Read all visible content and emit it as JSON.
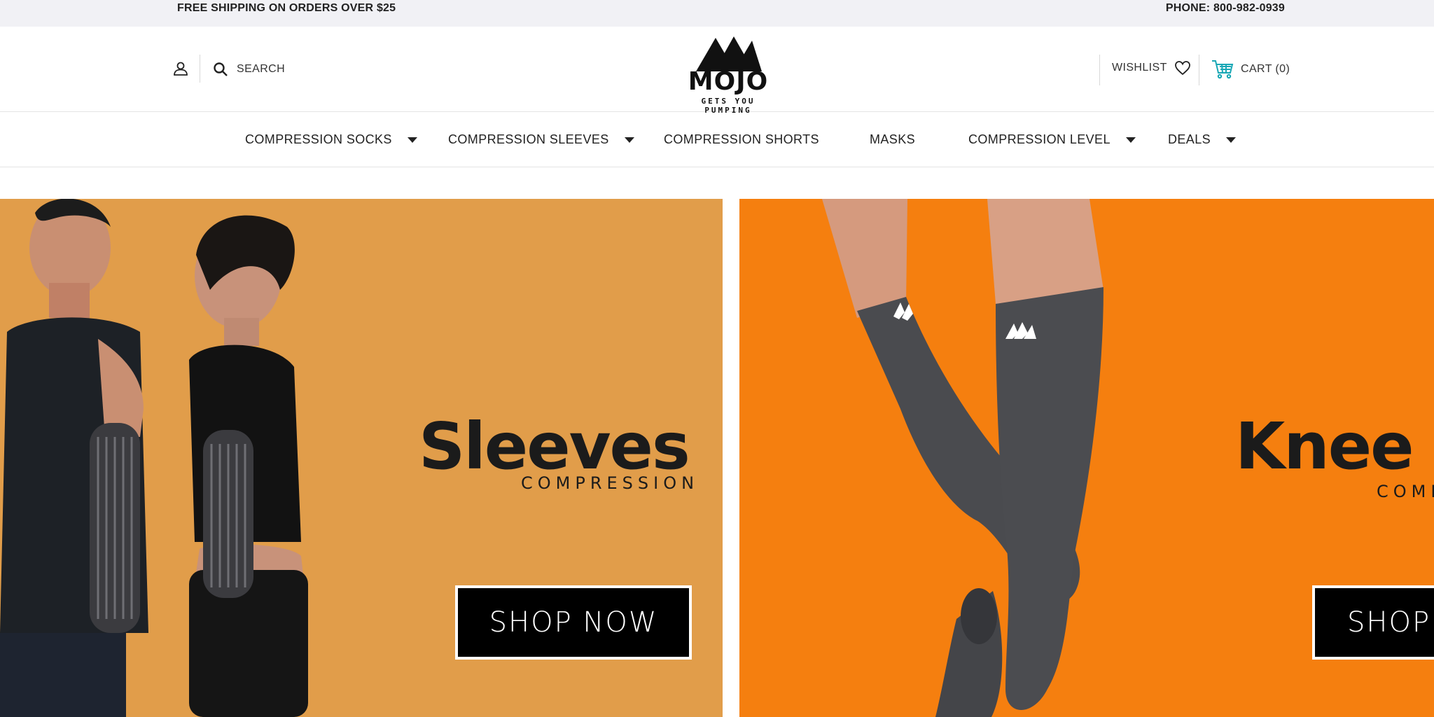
{
  "topbar": {
    "shipping": "FREE SHIPPING ON ORDERS OVER $25",
    "phone": "PHONE: 800-982-0939"
  },
  "header": {
    "search_label": "SEARCH",
    "logo_text": "MOJO",
    "logo_tagline": "GETS YOU PUMPING",
    "wishlist_label": "WISHLIST",
    "cart_label": "CART (0)",
    "cart_icon_color": "#18a7b5"
  },
  "nav": {
    "items": [
      {
        "label": "COMPRESSION SOCKS"
      },
      {
        "label": "COMPRESSION SLEEVES"
      },
      {
        "label": "COMPRESSION SHORTS"
      },
      {
        "label": "MASKS"
      },
      {
        "label": "COMPRESSION LEVEL"
      },
      {
        "label": "DEALS"
      }
    ]
  },
  "banners": [
    {
      "headline": "Sleeves",
      "subline": "COMPRESSION",
      "button": "SHOP NOW",
      "bg_color": "#e19d4a"
    },
    {
      "headline": "Knee H",
      "subline": "COMP",
      "button": "SHOP",
      "bg_color": "#f57f0f"
    }
  ]
}
